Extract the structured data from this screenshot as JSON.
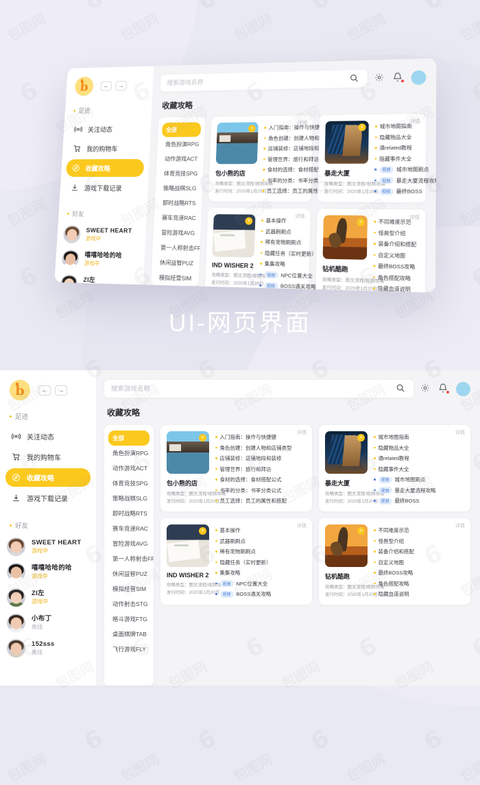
{
  "mock": {
    "caption": "UI-网页界面"
  },
  "app": {
    "logo_letter": "b",
    "nav": {
      "back": "←",
      "forward": "→"
    },
    "search": {
      "placeholder": "搜索游戏名称",
      "value": "",
      "icon": "search-icon"
    },
    "header_icons": {
      "settings": "gear-icon",
      "notifications": "bell-icon",
      "avatar": "user-avatar"
    },
    "page_title": "收藏攻略",
    "sidebar": {
      "sections": [
        {
          "label": "足迹",
          "items": [
            {
              "label": "关注动态",
              "icon": "broadcast-icon",
              "active": false
            },
            {
              "label": "我的购物车",
              "icon": "cart-icon",
              "active": false
            },
            {
              "label": "收藏攻略",
              "icon": "compass-icon",
              "active": true
            },
            {
              "label": "游戏下载记录",
              "icon": "download-icon",
              "active": false
            }
          ]
        },
        {
          "label": "好友",
          "friends": [
            {
              "name": "SWEET HEART",
              "status": "游戏中",
              "online": true
            },
            {
              "name": "嘻嘻哈哈的哈",
              "status": "游戏中",
              "online": true
            },
            {
              "name": "ZI左",
              "status": "游戏中",
              "online": true
            },
            {
              "name": "小布丁",
              "status": "离线",
              "online": false
            },
            {
              "name": "152sss",
              "status": "离线",
              "online": false
            }
          ]
        }
      ]
    },
    "categories": [
      {
        "label": "全部",
        "active": true
      },
      {
        "label": "角色扮演RPG",
        "active": false
      },
      {
        "label": "动作游戏ACT",
        "active": false
      },
      {
        "label": "体育竞技SPG",
        "active": false
      },
      {
        "label": "策略战棋SLG",
        "active": false
      },
      {
        "label": "即时战略RTS",
        "active": false
      },
      {
        "label": "赛车竞速RAC",
        "active": false
      },
      {
        "label": "冒险游戏AVG",
        "active": false
      },
      {
        "label": "第一人称射击FPS",
        "active": false
      },
      {
        "label": "休闲益智PUZ",
        "active": false
      },
      {
        "label": "模拟经营SIM",
        "active": false
      },
      {
        "label": "动作射击STG",
        "active": false
      },
      {
        "label": "格斗游戏FTG",
        "active": false
      },
      {
        "label": "桌面棋牌TAB",
        "active": false
      },
      {
        "label": "飞行游戏FLY",
        "active": false
      }
    ],
    "detail_label": "详情",
    "remove_label": "×",
    "cards": [
      {
        "title": "包小熊的店",
        "type_meta": "攻略类型：图文流程/视频攻略",
        "date_meta": "发行时间：2020年1月20日",
        "thumb": "t1",
        "items": [
          {
            "text": "入门指南：操作与快捷键",
            "video": false
          },
          {
            "text": "角色创建：创建人物和店铺类型",
            "video": false
          },
          {
            "text": "店铺装修：店铺地段和装修",
            "video": false
          },
          {
            "text": "管理世界：旅行和拜访",
            "video": false
          },
          {
            "text": "食材的选择：食材搭配公式",
            "video": false
          },
          {
            "text": "书率的分类：书率分类公式",
            "video": false
          },
          {
            "text": "员工选择：员工的属性和搭配",
            "video": false
          }
        ]
      },
      {
        "title": "暴走大厦",
        "type_meta": "攻略类型：图文流程/视频攻略",
        "date_meta": "发行时间：2020年1月20日",
        "thumb": "t2",
        "items": [
          {
            "text": "城市地图指南",
            "video": false
          },
          {
            "text": "隐藏物品大全",
            "video": false
          },
          {
            "text": "通related教程",
            "video": false
          },
          {
            "text": "隐藏事件大全",
            "video": false
          },
          {
            "text": "城市地图刷点",
            "video": true,
            "tag": "视频"
          },
          {
            "text": "暴走大厦流程攻略",
            "video": true,
            "tag": "视频"
          },
          {
            "text": "最终BOSS",
            "video": true,
            "tag": "视频"
          }
        ]
      },
      {
        "title": "IND WISHER 2",
        "type_meta": "攻略类型：图文流程/视频攻略",
        "date_meta": "发行时间：2020年1月20日",
        "thumb": "t3",
        "items": [
          {
            "text": "基本操作",
            "video": false
          },
          {
            "text": "武器刷刷点",
            "video": false
          },
          {
            "text": "稀有宠物刷刷点",
            "video": false
          },
          {
            "text": "隐藏任务（实时更新）",
            "video": false
          },
          {
            "text": "集集攻略",
            "video": false
          },
          {
            "text": "NPC位置大全",
            "video": true,
            "tag": "视频"
          },
          {
            "text": "BOSS通关攻略",
            "video": true,
            "tag": "视频"
          }
        ]
      },
      {
        "title": "钻机酷跑",
        "type_meta": "攻略类型：图文流程/视频攻略",
        "date_meta": "发行时间：2020年1月20日",
        "thumb": "t4",
        "items": [
          {
            "text": "不同难度示范",
            "video": false
          },
          {
            "text": "怪兽型介绍",
            "video": false
          },
          {
            "text": "装备介绍和搭配",
            "video": false
          },
          {
            "text": "自定义地图",
            "video": false
          },
          {
            "text": "最终BOSS攻略",
            "video": false
          },
          {
            "text": "角色搭配攻略",
            "video": false
          },
          {
            "text": "隐藏血道说明",
            "video": false
          }
        ]
      }
    ]
  },
  "watermark": {
    "text": "包图网",
    "mark": "6"
  },
  "colors": {
    "accent": "#fbc91e",
    "logo": "#f08a1c",
    "background": "#e9e9f2",
    "video_tag": "#4a7bd4"
  }
}
